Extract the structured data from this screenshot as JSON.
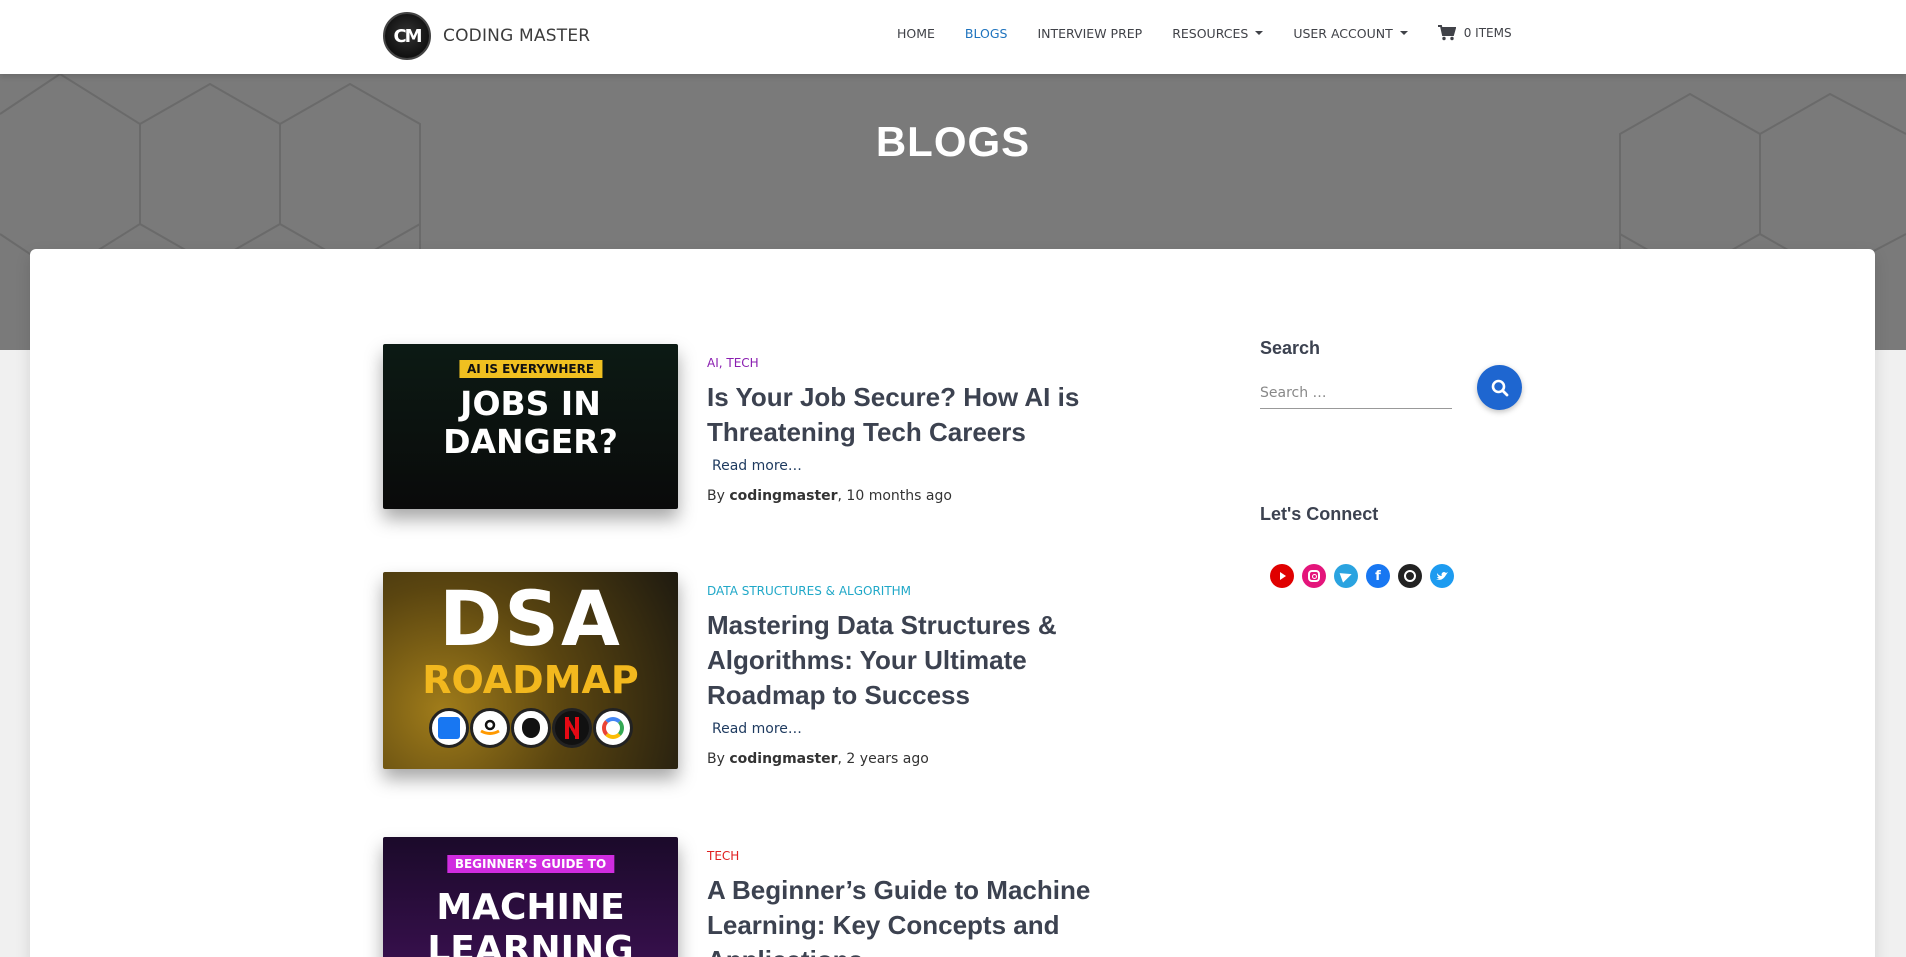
{
  "header": {
    "brand": "CODING MASTER",
    "logo_text": "CM",
    "nav": [
      {
        "label": "HOME"
      },
      {
        "label": "BLOGS",
        "active": true
      },
      {
        "label": "INTERVIEW PREP"
      },
      {
        "label": "RESOURCES",
        "dropdown": true
      },
      {
        "label": "USER ACCOUNT",
        "dropdown": true
      }
    ],
    "cart_label": "0 ITEMS"
  },
  "hero": {
    "title": "BLOGS"
  },
  "posts": [
    {
      "category": "AI, TECH",
      "category_color": "#8a1eb0",
      "title": "Is Your Job Secure? How AI is Threatening Tech Careers",
      "read_more": "Read more…",
      "by": "By ",
      "author": "codingmaster",
      "time": ", 10 months ago",
      "thumb_tag": "AI IS EVERYWHERE",
      "thumb_line1": "JOBS IN",
      "thumb_line2": "DANGER?"
    },
    {
      "category": "DATA STRUCTURES & ALGORITHM",
      "category_color": "#20a8c8",
      "title": "Mastering Data Structures & Algorithms: Your Ultimate Roadmap to Success",
      "read_more": "Read more…",
      "by": "By ",
      "author": "codingmaster",
      "time": ", 2 years ago",
      "thumb_line1": "DSA",
      "thumb_line2": "ROADMAP"
    },
    {
      "category": "TECH",
      "category_color": "#e02020",
      "title": "A Beginner’s Guide to Machine Learning: Key Concepts and Applications",
      "thumb_tag": "BEGINNER’S GUIDE TO",
      "thumb_line1": "MACHINE",
      "thumb_line2": "LEARNING"
    }
  ],
  "sidebar": {
    "search_heading": "Search",
    "search_placeholder": "Search …",
    "connect_heading": "Let's Connect",
    "socials": [
      {
        "icon": "youtube-icon",
        "color": "#e00000"
      },
      {
        "icon": "instagram-icon",
        "color": "#e4157b"
      },
      {
        "icon": "telegram-icon",
        "color": "#2aa3e0"
      },
      {
        "icon": "facebook-icon",
        "color": "#1877f2"
      },
      {
        "icon": "github-icon",
        "color": "#222222"
      },
      {
        "icon": "twitter-icon",
        "color": "#1d9bf0"
      }
    ]
  }
}
